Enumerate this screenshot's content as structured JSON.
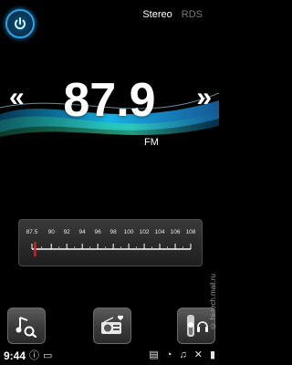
{
  "header": {
    "power_icon": "power-icon",
    "modes": [
      {
        "label": "Stereo",
        "active": true
      },
      {
        "label": "RDS",
        "active": false
      }
    ]
  },
  "tuner": {
    "frequency": "87.9",
    "band": "FM",
    "prev_icon": "double-chevron-left-icon",
    "next_icon": "double-chevron-right-icon"
  },
  "scale": {
    "labels": [
      "87.5",
      "90",
      "92",
      "94",
      "96",
      "98",
      "100",
      "102",
      "104",
      "106",
      "108"
    ],
    "marker_value": 87.9,
    "min": 87.5,
    "max": 108
  },
  "buttons": [
    {
      "name": "playlist-button",
      "icon": "playlist-icon"
    },
    {
      "name": "radio-button",
      "icon": "radio-favorite-icon"
    },
    {
      "name": "volume-button",
      "icon": "volume-headphones-icon"
    }
  ],
  "statusbar": {
    "time": "9:44",
    "watermark": "© hi-tech.mail.ru"
  },
  "colors": {
    "accent": "#2aa3e8",
    "marker": "#e01e1e"
  }
}
